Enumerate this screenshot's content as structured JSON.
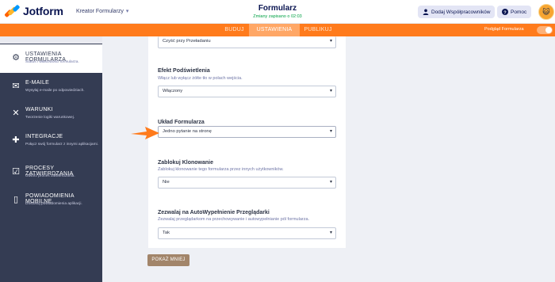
{
  "header": {
    "brand": "Jotform",
    "builder_label": "Kreator Formularzy",
    "form_title": "Formularz",
    "saved_status": "Zmiany zapisano o 02:03",
    "collab_button": "Dodaj Współpracowników",
    "help_button": "Pomoc"
  },
  "nav": {
    "tabs": [
      {
        "label": "BUDUJ"
      },
      {
        "label": "USTAWIENIA"
      },
      {
        "label": "PUBLIKUJ"
      }
    ],
    "active_tab": "USTAWIENIA",
    "preview_label": "Podgląd Formularza",
    "accent_color": "#ff7b1c"
  },
  "sidebar": {
    "items": [
      {
        "title": "USTAWIENIA FORMULARZA",
        "desc": "Status i właściwości formularza.",
        "icon": "gear-icon",
        "active": true
      },
      {
        "title": "E-MAILE",
        "desc": "Wysyłaj e-maile po odpowiedziach.",
        "icon": "envelope-icon",
        "active": false
      },
      {
        "title": "WARUNKI",
        "desc": "Tworzenie logiki warunkowej.",
        "icon": "shuffle-icon",
        "active": false
      },
      {
        "title": "INTEGRACJE",
        "desc": "Połącz swój formularz z innymi aplikacjami.",
        "icon": "puzzle-icon",
        "active": false
      },
      {
        "title": "PROCESY ZATWIERDZANIA",
        "desc": "Utwórz proces zatwierdzania.",
        "icon": "approval-icon",
        "active": false
      },
      {
        "title": "POWIADOMIENIA MOBILNE",
        "desc": "Dostosuj powiadomienia aplikacji.",
        "icon": "mobile-icon",
        "active": false
      }
    ]
  },
  "settings": {
    "clear_on_page_select": "Czyść przy Przeładaniu",
    "highlight_effect": {
      "label": "Efekt Podświetlenia",
      "desc": "Włącz lub wyłącz żółte tło w polach wejścia.",
      "value": "Włączony"
    },
    "form_layout": {
      "label": "Układ Formularza",
      "value": "Jedno pytanie na stronę"
    },
    "clone_lock": {
      "label": "Zablokuj Klonowanie",
      "desc": "Zablokuj klonowanie tego formularza przez innych użytkowników.",
      "value": "Nie"
    },
    "autofill": {
      "label": "Zezwalaj na AutoWypełnienie Przeglądarki",
      "desc": "Zezwalaj przeglądarkom na przechowywanie i autowypełnianie pól formularza.",
      "value": "Tak"
    },
    "show_less_button": "POKAŻ MNIEJ"
  }
}
